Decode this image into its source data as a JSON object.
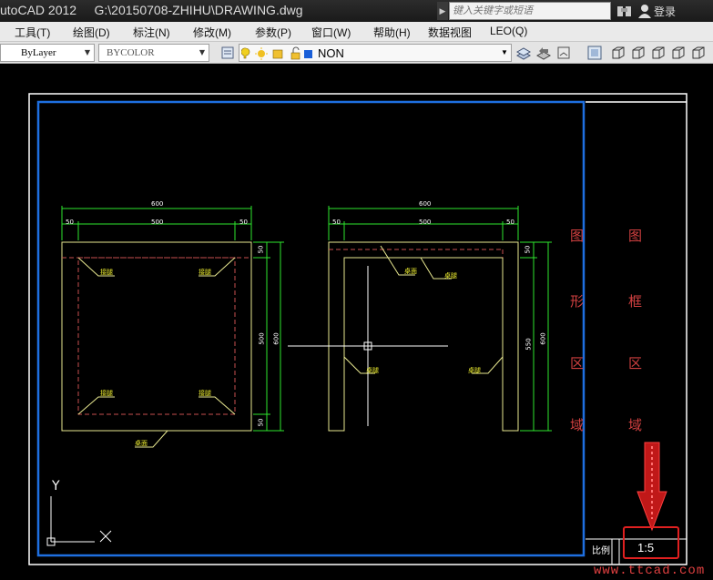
{
  "titlebar": {
    "app_name": "utoCAD 2012",
    "file_path": "G:\\20150708-ZHIHU\\DRAWING.dwg",
    "search_placeholder": "键入关键字或短语",
    "login_label": "登录"
  },
  "menu": [
    "工具(T)",
    "绘图(D)",
    "标注(N)",
    "修改(M)",
    "参数(P)",
    "窗口(W)",
    "帮助(H)",
    "数据视图",
    "LEO(Q)"
  ],
  "toolbar": {
    "linetype": "ByLayer",
    "color": "BYCOLOR",
    "layer": "NON"
  },
  "drawing": {
    "left_view": {
      "dim_total": "600",
      "dim_inner": "500",
      "dim_edge_left": "50",
      "dim_edge_right": "50",
      "dim_right_top": "50",
      "dim_right_mid": "500",
      "dim_right_total": "600",
      "dim_right_bottom": "50",
      "label_tl": "接腿",
      "label_tr": "接腿",
      "label_bl": "接腿",
      "label_br": "接腿",
      "label_bottom": "桌面"
    },
    "right_view": {
      "dim_total": "600",
      "dim_inner": "500",
      "dim_edge_left": "50",
      "dim_edge_right": "50",
      "dim_right_top": "50",
      "dim_right_mid": "550",
      "dim_right_total": "600",
      "label_1": "桌面",
      "label_2": "桌腿",
      "label_3": "桌腿",
      "label_4": "桌腿"
    },
    "region_graphic": [
      "图",
      "形",
      "区",
      "域"
    ],
    "region_frame": [
      "图",
      "框",
      "区",
      "域"
    ],
    "ucs_y": "Y",
    "scale_label": "比例",
    "scale_value": "1:5"
  },
  "watermark": "www.ttcad.com",
  "colors": {
    "border_blue": "#1e6fe0",
    "frame_white": "#ffffff",
    "dim_green": "#2ee62e",
    "outline_yellow": "#e8e890",
    "hidden_red": "#c85050",
    "region_text_red": "#d04040",
    "arrow_red": "#e02020"
  }
}
